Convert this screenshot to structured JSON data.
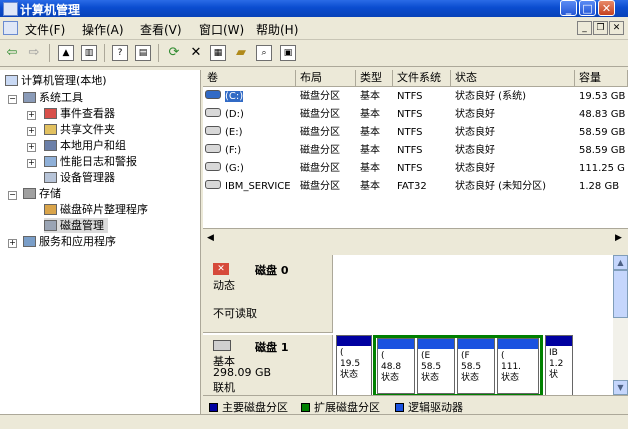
{
  "window": {
    "title": "计算机管理",
    "accent": "#0a4ccf"
  },
  "menu": [
    "文件(F)",
    "操作(A)",
    "查看(V)",
    "窗口(W)",
    "帮助(H)"
  ],
  "tree": {
    "root": "计算机管理(本地)",
    "system_tools": "系统工具",
    "event_viewer": "事件查看器",
    "shared_folders": "共享文件夹",
    "local_users": "本地用户和组",
    "perf_logs": "性能日志和警报",
    "device_manager": "设备管理器",
    "storage": "存储",
    "defrag": "磁盘碎片整理程序",
    "disk_mgmt": "磁盘管理",
    "services": "服务和应用程序"
  },
  "columns": [
    "卷",
    "布局",
    "类型",
    "文件系统",
    "状态",
    "容量"
  ],
  "volumes": [
    {
      "name": "(C:)",
      "layout": "磁盘分区",
      "type": "基本",
      "fs": "NTFS",
      "status": "状态良好 (系统)",
      "capacity": "19.53 GB"
    },
    {
      "name": "(D:)",
      "layout": "磁盘分区",
      "type": "基本",
      "fs": "NTFS",
      "status": "状态良好",
      "capacity": "48.83 GB"
    },
    {
      "name": "(E:)",
      "layout": "磁盘分区",
      "type": "基本",
      "fs": "NTFS",
      "status": "状态良好",
      "capacity": "58.59 GB"
    },
    {
      "name": "(F:)",
      "layout": "磁盘分区",
      "type": "基本",
      "fs": "NTFS",
      "status": "状态良好",
      "capacity": "58.59 GB"
    },
    {
      "name": "(G:)",
      "layout": "磁盘分区",
      "type": "基本",
      "fs": "NTFS",
      "status": "状态良好",
      "capacity": "111.25 G"
    },
    {
      "name": "IBM_SERVICE",
      "layout": "磁盘分区",
      "type": "基本",
      "fs": "FAT32",
      "status": "状态良好 (未知分区)",
      "capacity": "1.28 GB"
    }
  ],
  "disk0": {
    "label": "磁盘 0",
    "state": "动态",
    "message": "不可读取"
  },
  "disk1": {
    "label": "磁盘 1",
    "type": "基本",
    "size": "298.09 GB",
    "state": "联机"
  },
  "disk1_parts": [
    {
      "name": "(",
      "size": "19.5",
      "status": "状态"
    },
    {
      "name": "(",
      "size": "48.8",
      "status": "状态"
    },
    {
      "name": "(E",
      "size": "58.5",
      "status": "状态"
    },
    {
      "name": "(F",
      "size": "58.5",
      "status": "状态"
    },
    {
      "name": "(",
      "size": "111.",
      "status": "状态"
    },
    {
      "name": "IB",
      "size": "1.2",
      "status": "状"
    }
  ],
  "legend": {
    "primary": "主要磁盘分区",
    "extended": "扩展磁盘分区",
    "logical": "逻辑驱动器"
  },
  "colors": {
    "primary": "#0000a0",
    "extended": "#008000",
    "logical": "#1b52e0",
    "selection": "#316ac5"
  }
}
